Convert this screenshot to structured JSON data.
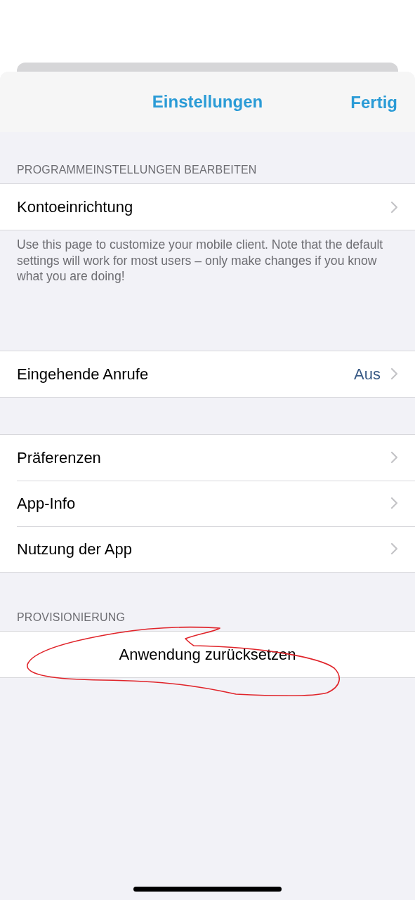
{
  "nav_bar": {
    "title": "Einstellungen",
    "done_button": "Fertig"
  },
  "sections": [
    {
      "header": "PROGRAMMEINSTELLUNGEN BEARBEITEN",
      "rows": [
        {
          "label": "Kontoeinrichtung",
          "kind": "link"
        }
      ],
      "footer": "Use this page to customize your mobile client. Note that the default settings will work for most users – only make changes if you know what you are doing!"
    },
    {
      "rows": [
        {
          "label": "Eingehende Anrufe",
          "value": "Aus",
          "kind": "link"
        }
      ]
    },
    {
      "rows": [
        {
          "label": "Präferenzen",
          "kind": "link"
        },
        {
          "label": "App-Info",
          "kind": "link"
        },
        {
          "label": "Nutzung der App",
          "kind": "link"
        }
      ]
    },
    {
      "header": "PROVISIONIERUNG",
      "rows": [
        {
          "label": "Anwendung zurücksetzen",
          "kind": "action",
          "circled": true
        }
      ]
    }
  ]
}
